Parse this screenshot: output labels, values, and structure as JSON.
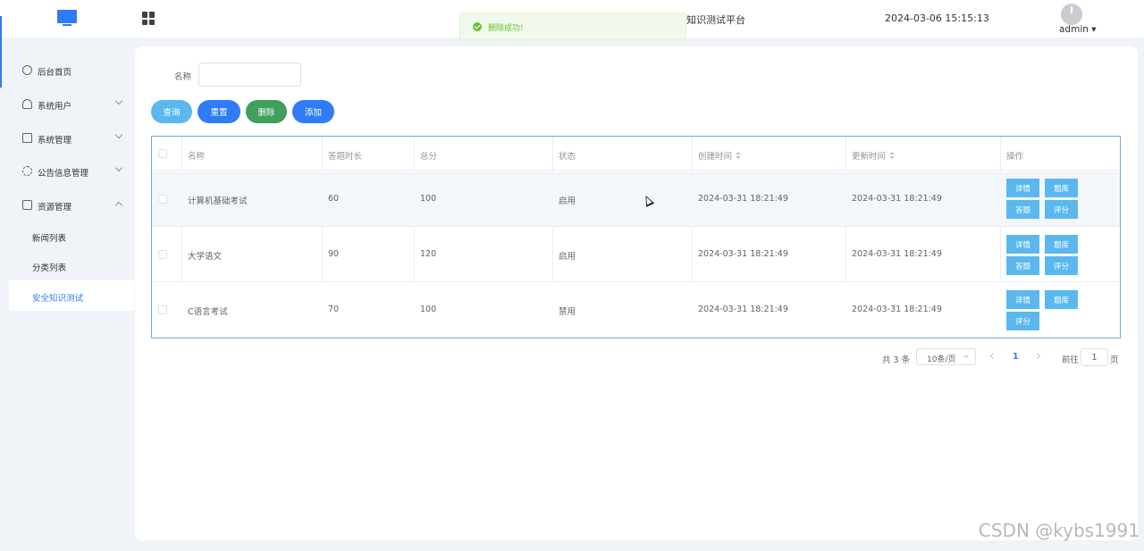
{
  "header": {
    "title": "知识测试平台",
    "datetime": "2024-03-06 15:15:13",
    "user": "admin ▾"
  },
  "toast": {
    "message": "删除成功!"
  },
  "sidebar": {
    "items": [
      {
        "label": "后台首页",
        "icon": "clock-icon"
      },
      {
        "label": "系统用户",
        "icon": "user-icon"
      },
      {
        "label": "系统管理",
        "icon": "folder-icon"
      },
      {
        "label": "公告信息管理",
        "icon": "spark-icon"
      },
      {
        "label": "资源管理",
        "icon": "printer-icon"
      }
    ],
    "sub_items": [
      {
        "label": "新闻列表"
      },
      {
        "label": "分类列表"
      },
      {
        "label": "安全知识测试"
      }
    ]
  },
  "search": {
    "label": "名称",
    "value": ""
  },
  "toolbar": {
    "query": "查询",
    "reset": "重置",
    "delete": "删除",
    "add": "添加"
  },
  "table": {
    "headers": [
      "名称",
      "答题时长",
      "总分",
      "状态",
      "创建时间",
      "更新时间",
      "操作"
    ],
    "rows": [
      {
        "name": "计算机基础考试",
        "duration": "60",
        "score": "100",
        "status": "启用",
        "created": "2024-03-31 18:21:49",
        "updated": "2024-03-31 18:21:49"
      },
      {
        "name": "大学语文",
        "duration": "90",
        "score": "120",
        "status": "启用",
        "created": "2024-03-31 18:21:49",
        "updated": "2024-03-31 18:21:49"
      },
      {
        "name": "C语言考试",
        "duration": "70",
        "score": "100",
        "status": "禁用",
        "created": "2024-03-31 18:21:49",
        "updated": "2024-03-31 18:21:49"
      }
    ],
    "actions": {
      "detail": "详情",
      "bank": "题库",
      "answer": "答题",
      "grade": "评分"
    }
  },
  "pagination": {
    "total": "共 3 条",
    "page_size": "10条/页",
    "current": "1",
    "goto_label": "前往",
    "goto_value": "1",
    "page_suffix": "页"
  },
  "watermark": "CSDN @kybs1991",
  "colors": {
    "primary": "#2f7cf6",
    "info": "#5ab8ef",
    "danger_green": "#3f9f5b",
    "success": "#67c23a"
  }
}
